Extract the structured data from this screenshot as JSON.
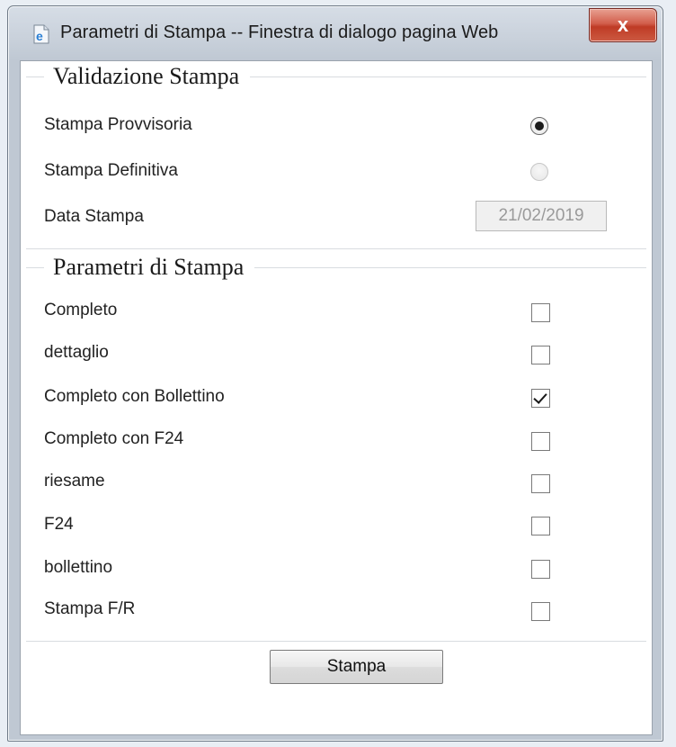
{
  "window": {
    "title": "Parametri di Stampa -- Finestra di dialogo pagina Web",
    "close_glyph": "x",
    "icon": "ie-page-icon"
  },
  "validazione": {
    "legend": "Validazione Stampa",
    "provvisoria_label": "Stampa Provvisoria",
    "definitiva_label": "Stampa Definitiva",
    "data_label": "Data Stampa",
    "data_value": "21/02/2019",
    "selected": "provvisoria"
  },
  "parametri": {
    "legend": "Parametri di Stampa",
    "options": [
      {
        "label": "Completo",
        "checked": false
      },
      {
        "label": "dettaglio",
        "checked": false
      },
      {
        "label": "Completo con Bollettino",
        "checked": true
      },
      {
        "label": "Completo con F24",
        "checked": false
      },
      {
        "label": "riesame",
        "checked": false
      },
      {
        "label": "F24",
        "checked": false
      },
      {
        "label": "bollettino",
        "checked": false
      },
      {
        "label": "Stampa F/R",
        "checked": false
      }
    ]
  },
  "actions": {
    "print_label": "Stampa"
  },
  "colors": {
    "close_button": "#c8442e",
    "client_bg": "#ffffff",
    "legend_line": "#d9dce0"
  }
}
